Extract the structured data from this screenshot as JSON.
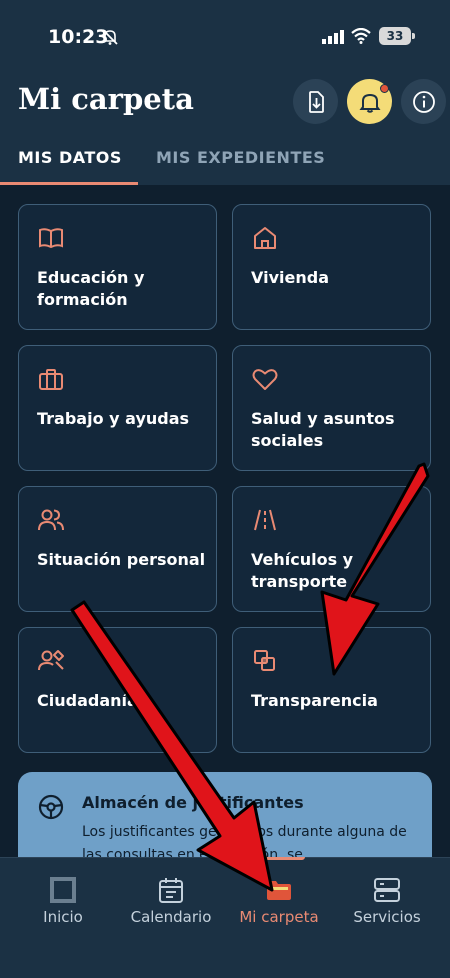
{
  "status": {
    "time": "10:23",
    "battery": "33"
  },
  "header": {
    "title": "Mi carpeta"
  },
  "tabs": [
    {
      "label": "MIS DATOS",
      "active": true
    },
    {
      "label": "MIS EXPEDIENTES",
      "active": false
    }
  ],
  "cards": [
    {
      "label": "Educación y formación",
      "icon": "book-icon"
    },
    {
      "label": "Vivienda",
      "icon": "house-icon"
    },
    {
      "label": "Trabajo y ayudas",
      "icon": "briefcase-icon"
    },
    {
      "label": "Salud y asuntos sociales",
      "icon": "heart-icon"
    },
    {
      "label": "Situación personal",
      "icon": "people-icon"
    },
    {
      "label": "Vehículos y transporte",
      "icon": "road-icon"
    },
    {
      "label": "Ciudadanía",
      "icon": "citizen-icon"
    },
    {
      "label": "Transparencia",
      "icon": "transparency-icon"
    }
  ],
  "info_card": {
    "title": "Almacén de justificantes",
    "text": "Los justificantes generados durante alguna de las consultas en esta sesión, se"
  },
  "bottom_nav": [
    {
      "label": "Inicio",
      "icon": "home-square-icon",
      "active": false
    },
    {
      "label": "Calendario",
      "icon": "calendar-icon",
      "active": false
    },
    {
      "label": "Mi carpeta",
      "icon": "folder-icon",
      "active": true
    },
    {
      "label": "Servicios",
      "icon": "server-icon",
      "active": false
    }
  ],
  "colors": {
    "accent": "#e98a73",
    "header_bg": "#1b3144",
    "page_bg": "#0f1f2e",
    "bell_bg": "#f4dc78",
    "info_bg": "#6fa0c8",
    "arrow": "#e0141a"
  }
}
